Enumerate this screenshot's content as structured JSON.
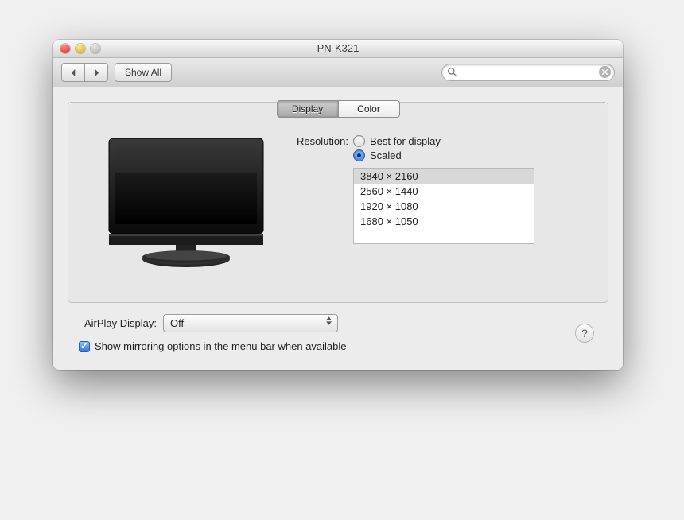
{
  "window": {
    "title": "PN-K321"
  },
  "toolbar": {
    "show_all": "Show All",
    "search_placeholder": ""
  },
  "tabs": {
    "display": "Display",
    "color": "Color"
  },
  "resolution": {
    "label": "Resolution:",
    "best": "Best for display",
    "scaled": "Scaled",
    "selected": "scaled",
    "options": [
      "3840 × 2160",
      "2560 × 1440",
      "1920 × 1080",
      "1680 × 1050"
    ],
    "selected_index": 0
  },
  "airplay": {
    "label": "AirPlay Display:",
    "value": "Off"
  },
  "mirror": {
    "label": "Show mirroring options in the menu bar when available",
    "checked": true
  },
  "help": "?"
}
